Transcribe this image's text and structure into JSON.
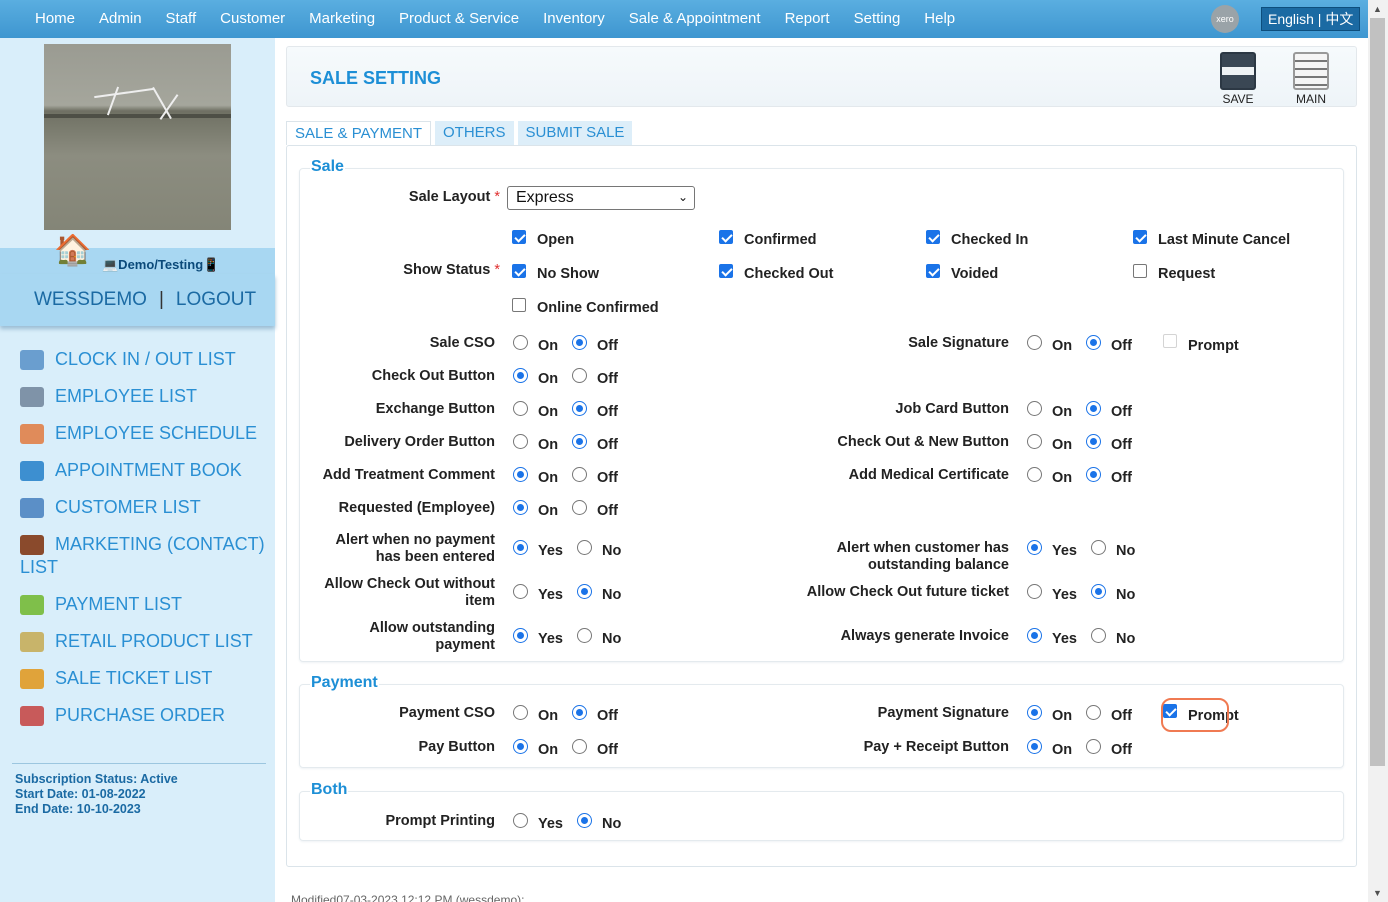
{
  "topnav": {
    "items": [
      "Home",
      "Admin",
      "Staff",
      "Customer",
      "Marketing",
      "Product & Service",
      "Inventory",
      "Sale & Appointment",
      "Report",
      "Setting",
      "Help"
    ],
    "xero_label": "xero",
    "language": "English | 中文"
  },
  "sidebar": {
    "badge": "💻Demo/Testing📱",
    "user": "WESSDEMO",
    "separator": "|",
    "logout": "LOGOUT",
    "nav": [
      "CLOCK IN / OUT LIST",
      "EMPLOYEE LIST",
      "EMPLOYEE SCHEDULE",
      "APPOINTMENT BOOK",
      "CUSTOMER LIST",
      "MARKETING (CONTACT) LIST",
      "PAYMENT LIST",
      "RETAIL PRODUCT LIST",
      "SALE TICKET LIST",
      "PURCHASE ORDER"
    ],
    "subscription": {
      "status": "Subscription Status: Active",
      "start": "Start Date: 01-08-2022",
      "end": "End Date: 10-10-2023"
    }
  },
  "header": {
    "title": "SALE SETTING",
    "save": "SAVE",
    "main": "MAIN"
  },
  "tabs": [
    "SALE & PAYMENT",
    "OTHERS",
    "SUBMIT SALE"
  ],
  "sale": {
    "legend": "Sale",
    "layout_label": "Sale Layout",
    "layout_value": "Express",
    "required": "*",
    "status_label": "Show Status",
    "statuses": [
      {
        "label": "Open",
        "checked": true
      },
      {
        "label": "Confirmed",
        "checked": true
      },
      {
        "label": "Checked In",
        "checked": true
      },
      {
        "label": "Last Minute Cancel",
        "checked": true
      },
      {
        "label": "No Show",
        "checked": true
      },
      {
        "label": "Checked Out",
        "checked": true
      },
      {
        "label": "Voided",
        "checked": true
      },
      {
        "label": "Request",
        "checked": false
      },
      {
        "label": "Online Confirmed",
        "checked": false
      }
    ],
    "left": [
      {
        "label": "Sale CSO",
        "opts": [
          "On",
          "Off"
        ],
        "sel": 1
      },
      {
        "label": "Check Out Button",
        "opts": [
          "On",
          "Off"
        ],
        "sel": 0
      },
      {
        "label": "Exchange Button",
        "opts": [
          "On",
          "Off"
        ],
        "sel": 1
      },
      {
        "label": "Delivery Order Button",
        "opts": [
          "On",
          "Off"
        ],
        "sel": 1
      },
      {
        "label": "Add Treatment Comment",
        "opts": [
          "On",
          "Off"
        ],
        "sel": 0
      },
      {
        "label": "Requested (Employee)",
        "opts": [
          "On",
          "Off"
        ],
        "sel": 0
      },
      {
        "label": "Alert when no payment has been entered",
        "opts": [
          "Yes",
          "No"
        ],
        "sel": 0
      },
      {
        "label": "Allow Check Out without item",
        "opts": [
          "Yes",
          "No"
        ],
        "sel": 1
      },
      {
        "label": "Allow outstanding payment",
        "opts": [
          "Yes",
          "No"
        ],
        "sel": 0
      }
    ],
    "right": [
      {
        "label": "Sale Signature",
        "opts": [
          "On",
          "Off"
        ],
        "sel": 1,
        "prompt": "Prompt"
      },
      {
        "label": "Job Card Button",
        "opts": [
          "On",
          "Off"
        ],
        "sel": 1
      },
      {
        "label": "Check Out & New Button",
        "opts": [
          "On",
          "Off"
        ],
        "sel": 1
      },
      {
        "label": "Add Medical Certificate",
        "opts": [
          "On",
          "Off"
        ],
        "sel": 1
      },
      {
        "label": "Alert when customer has outstanding balance",
        "opts": [
          "Yes",
          "No"
        ],
        "sel": 0
      },
      {
        "label": "Allow Check Out future ticket",
        "opts": [
          "Yes",
          "No"
        ],
        "sel": 1
      },
      {
        "label": "Always generate Invoice",
        "opts": [
          "Yes",
          "No"
        ],
        "sel": 0
      }
    ]
  },
  "payment": {
    "legend": "Payment",
    "left": [
      {
        "label": "Payment CSO",
        "opts": [
          "On",
          "Off"
        ],
        "sel": 1
      },
      {
        "label": "Pay Button",
        "opts": [
          "On",
          "Off"
        ],
        "sel": 0
      }
    ],
    "right": [
      {
        "label": "Payment Signature",
        "opts": [
          "On",
          "Off"
        ],
        "sel": 0,
        "prompt": "Prompt",
        "prompt_checked": true
      },
      {
        "label": "Pay + Receipt Button",
        "opts": [
          "On",
          "Off"
        ],
        "sel": 0
      }
    ]
  },
  "both": {
    "legend": "Both",
    "rows": [
      {
        "label": "Prompt Printing",
        "opts": [
          "Yes",
          "No"
        ],
        "sel": 1
      }
    ]
  },
  "footer": {
    "modified": "Modified07-03-2023 12:12 PM (wessdemo):"
  }
}
